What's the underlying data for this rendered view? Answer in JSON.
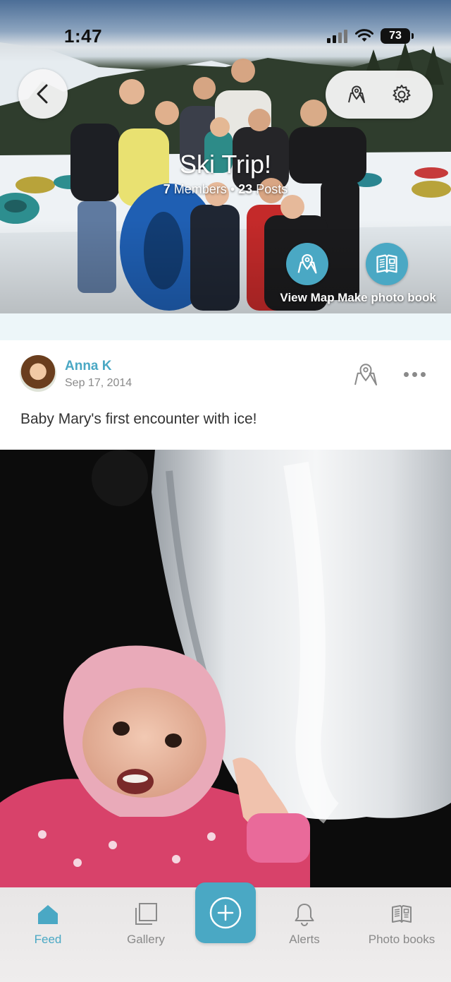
{
  "status_bar": {
    "time": "1:47",
    "battery": "73"
  },
  "group": {
    "title": "Ski Trip!",
    "members_count": "7",
    "members_label": "Members",
    "dot": "•",
    "posts_count": "23",
    "posts_label": "Posts"
  },
  "hero_actions": {
    "view_map": "View Map",
    "make_photo_book": "Make photo book"
  },
  "post": {
    "author": "Anna K",
    "date": "Sep 17, 2014",
    "text": "Baby Mary's first encounter with ice!"
  },
  "tabs": [
    {
      "label": "Feed",
      "icon": "home-icon",
      "active": true
    },
    {
      "label": "Gallery",
      "icon": "gallery-icon",
      "active": false
    },
    {
      "label": "Alerts",
      "icon": "bell-icon",
      "active": false
    },
    {
      "label": "Photo books",
      "icon": "book-icon",
      "active": false
    }
  ],
  "colors": {
    "accent": "#4aa8c4",
    "separator": "#edf6f9",
    "muted_text": "#8a8a8a"
  }
}
